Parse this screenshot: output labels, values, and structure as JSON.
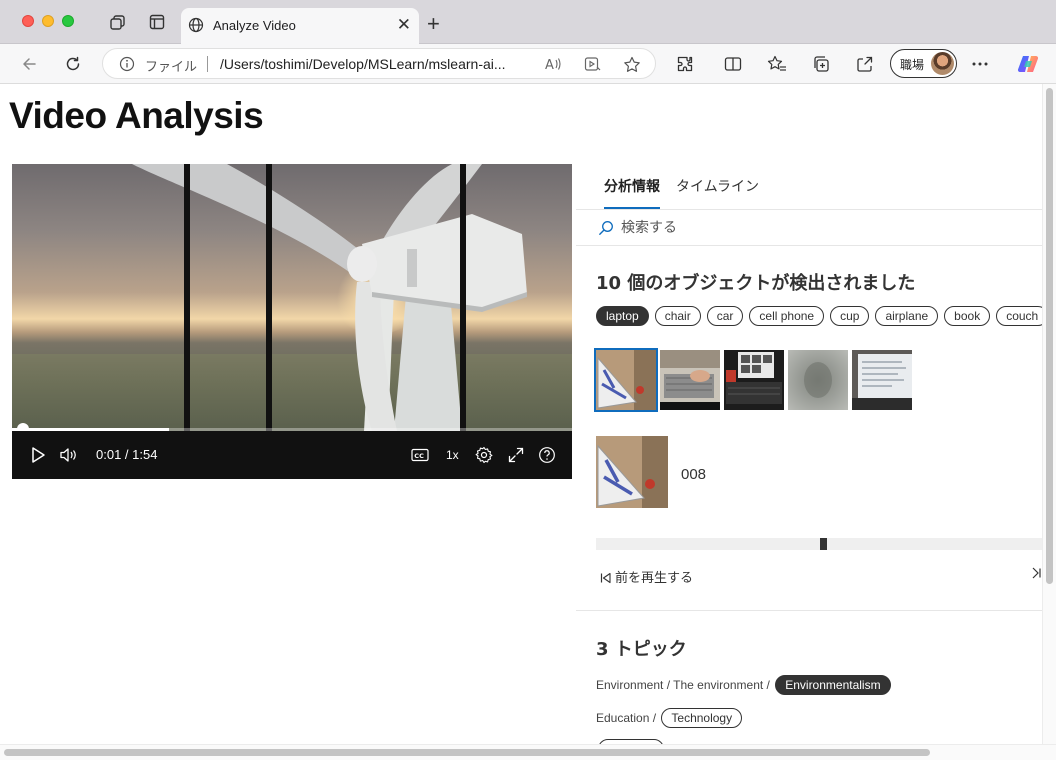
{
  "browser": {
    "tab_title": "Analyze Video",
    "address_protocol": "ファイル",
    "address_url": "/Users/toshimi/Develop/MSLearn/mslearn-ai...",
    "profile_label": "職場"
  },
  "page": {
    "title": "Video Analysis"
  },
  "player": {
    "time_display": "0:01 / 1:54",
    "speed": "1x",
    "progress_fraction": 0.0087
  },
  "insights": {
    "tabs": [
      {
        "label": "分析情報",
        "active": true
      },
      {
        "label": "タイムライン",
        "active": false
      }
    ],
    "search_placeholder": "検索する",
    "objects": {
      "title": "10 個のオブジェクトが検出されました",
      "chips": [
        "laptop",
        "chair",
        "car",
        "cell phone",
        "cup",
        "airplane",
        "book",
        "couch"
      ],
      "selected_chip": "laptop",
      "instance_label": "008",
      "prev_label": "前を再生する"
    },
    "topics": {
      "title": "3 トピック",
      "rows": [
        {
          "path": "Environment / The environment /",
          "chip": "Environmentalism",
          "chip_selected": true
        },
        {
          "path": "Education /",
          "chip": "Technology",
          "chip_selected": false
        }
      ]
    }
  }
}
